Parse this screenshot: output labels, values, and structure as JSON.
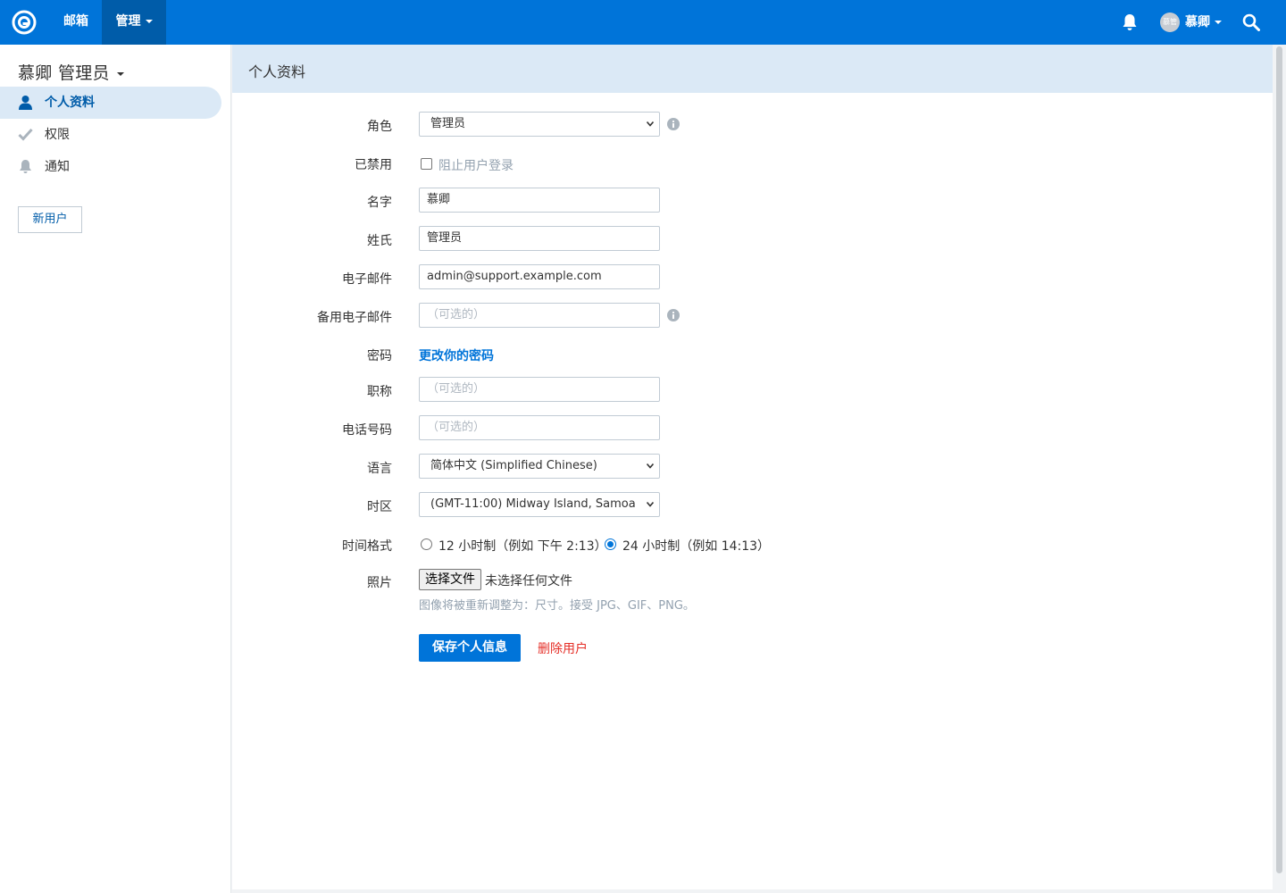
{
  "navbar": {
    "mailbox": "邮箱",
    "manage": "管理",
    "user_name": "慕卿",
    "avatar_initials": "慕管"
  },
  "sidebar": {
    "title": "慕卿 管理员",
    "items": [
      {
        "label": "个人资料",
        "icon": "user-icon",
        "active": true
      },
      {
        "label": "权限",
        "icon": "check-icon",
        "active": false
      },
      {
        "label": "通知",
        "icon": "bell-icon",
        "active": false
      }
    ],
    "new_user": "新用户"
  },
  "content": {
    "title": "个人资料"
  },
  "form": {
    "role": {
      "label": "角色",
      "value": "管理员"
    },
    "disabled": {
      "label": "已禁用",
      "checkbox_label": "阻止用户登录",
      "checked": false
    },
    "first_name": {
      "label": "名字",
      "value": "慕卿"
    },
    "last_name": {
      "label": "姓氏",
      "value": "管理员"
    },
    "email": {
      "label": "电子邮件",
      "value": "admin@support.example.com"
    },
    "alt_email": {
      "label": "备用电子邮件",
      "placeholder": "（可选的）"
    },
    "password": {
      "label": "密码",
      "link": "更改你的密码"
    },
    "job_title": {
      "label": "职称",
      "placeholder": "（可选的）"
    },
    "phone": {
      "label": "电话号码",
      "placeholder": "（可选的）"
    },
    "language": {
      "label": "语言",
      "value": "简体中文 (Simplified Chinese)"
    },
    "timezone": {
      "label": "时区",
      "value": "(GMT-11:00) Midway Island, Samoa"
    },
    "time_format": {
      "label": "时间格式",
      "option_12": "12 小时制（例如 下午 2:13）",
      "option_24": "24 小时制（例如 14:13）",
      "selected": "24"
    },
    "photo": {
      "label": "照片",
      "button": "选择文件",
      "status": "未选择任何文件",
      "help": "图像将被重新调整为：尺寸。接受 JPG、GIF、PNG。"
    },
    "save": "保存个人信息",
    "delete": "删除用户"
  },
  "colors": {
    "brand": "#0074d9",
    "brand_dark": "#005ca9",
    "active_bg": "#dbe9f6",
    "danger": "#e52f28"
  }
}
